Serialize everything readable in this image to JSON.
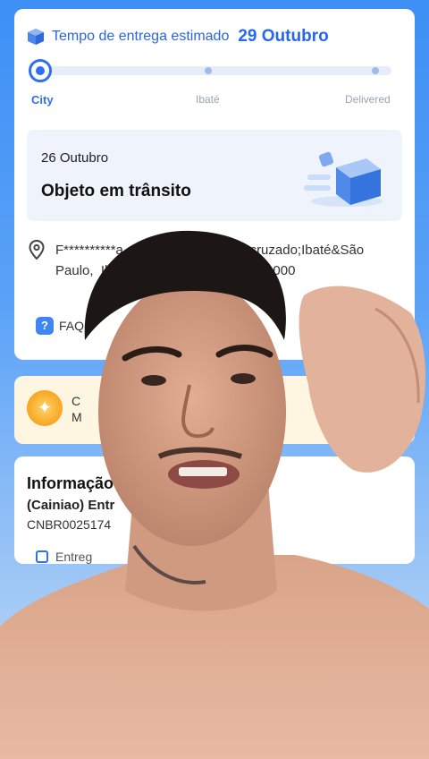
{
  "tracking": {
    "eta_label": "Tempo de entrega estimado",
    "eta_date": "29 Outubro",
    "steps": [
      {
        "label": "City"
      },
      {
        "label": "Ibaté"
      },
      {
        "label": "Delivered"
      }
    ],
    "progress_fraction": 0.0,
    "status": {
      "date": "26 Outubro",
      "title": "Objeto em trânsito"
    },
    "address_line1": "F**********a                          rdim cruzado;Ibaté&São",
    "address_line2": "Paulo,  Ib                                  4815-000",
    "faq_label": "FAQ"
  },
  "promo": {
    "line1": "C",
    "line2": "M"
  },
  "info": {
    "title": "Informação",
    "carrier": "(Cainiao) Entr",
    "code": "CNBR0025174",
    "button_label": "Entreg"
  },
  "colors": {
    "accent": "#2467f0",
    "background": "#3d8ff5",
    "status_box": "#eef3fc",
    "promo_bg": "#fff6e2"
  },
  "overlay": {
    "description_icon": "person-selfie-photo"
  }
}
